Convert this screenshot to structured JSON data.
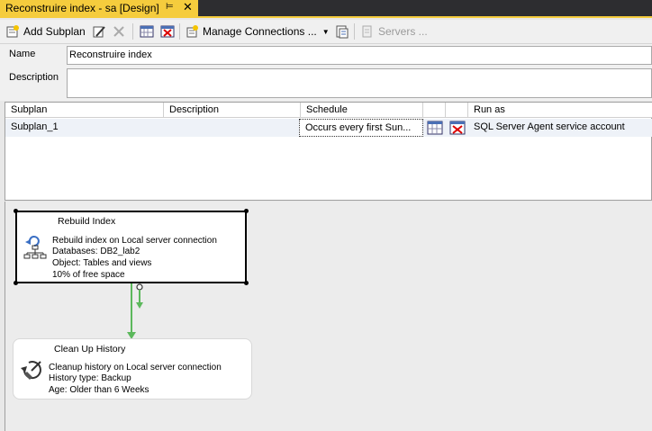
{
  "tab": {
    "title": "Reconstruire index - sa [Design]",
    "pin": "⊨",
    "close": "✕"
  },
  "toolbar": {
    "add_subplan": "Add Subplan",
    "manage_connections": "Manage Connections ...",
    "servers": "Servers ..."
  },
  "properties": {
    "name_label": "Name",
    "name_value": "Reconstruire index",
    "description_label": "Description",
    "description_value": ""
  },
  "subplans": {
    "columns": [
      "Subplan",
      "Description",
      "Schedule",
      "",
      "",
      "Run as"
    ],
    "rows": [
      {
        "subplan": "Subplan_1",
        "description": "",
        "schedule": "Occurs every first Sun...",
        "run_as": "SQL Server Agent service account"
      }
    ]
  },
  "tasks": [
    {
      "title": "Rebuild Index",
      "lines": [
        "Rebuild index on Local server connection",
        "Databases: DB2_lab2",
        "Object: Tables and views",
        "10% of free space"
      ]
    },
    {
      "title": "Clean Up History",
      "lines": [
        "Cleanup history on Local server connection",
        "History type: Backup",
        "Age: Older than 6 Weeks"
      ]
    }
  ],
  "colors": {
    "tab_accent": "#f5cc3d",
    "precedence_arrow": "#5cb85c",
    "selected_row": "#eef2f8"
  }
}
